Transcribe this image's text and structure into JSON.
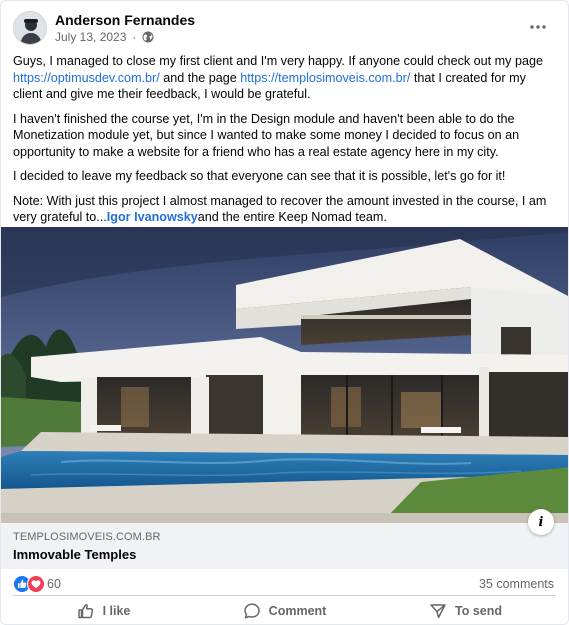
{
  "post": {
    "author_name": "Anderson Fernandes",
    "date": "July 13, 2023",
    "audience_icon": "globe-icon",
    "more_icon": "more-horizontal-icon",
    "paragraphs": [
      {
        "t1": "Guys, I managed to close my first client and I'm very happy. If anyone could check out my page ",
        "link1": "https://optimusdev.com.br/",
        "t2": " and the page ",
        "link2": "https://templosimoveis.com.br/",
        "t3": " that I created for my client and give me their feedback, I would be grateful."
      },
      {
        "text": "I haven't finished the course yet, I'm in the Design module and haven't been able to do the Monetization module yet, but since I wanted to make some money I decided to focus on an opportunity to make a website for a friend who has a real estate agency here in my city."
      },
      {
        "text": "I decided to leave my feedback so that everyone can see that it is possible, let's go for it!"
      },
      {
        "t1": "Note: With just this project I almost managed to recover the amount invested in the course, I am very grateful to...",
        "mention": "Igor Ivanowsky",
        "t2": "and the entire Keep Nomad team."
      }
    ]
  },
  "link_preview": {
    "domain": "TEMPLOSIMOVEIS.COM.BR",
    "title": "Immovable Temples",
    "info_icon": "info-icon"
  },
  "engagement": {
    "reactions": [
      "like-reaction-icon",
      "love-reaction-icon"
    ],
    "reaction_count": "60",
    "comments": "35 comments"
  },
  "actions": {
    "like": "I like",
    "comment": "Comment",
    "send": "To send"
  },
  "colors": {
    "link": "#216fdb",
    "secondary_text": "#65676b",
    "like_blue": "#1877f2",
    "love_red": "#f33e58",
    "preview_bg": "#f0f2f5"
  }
}
